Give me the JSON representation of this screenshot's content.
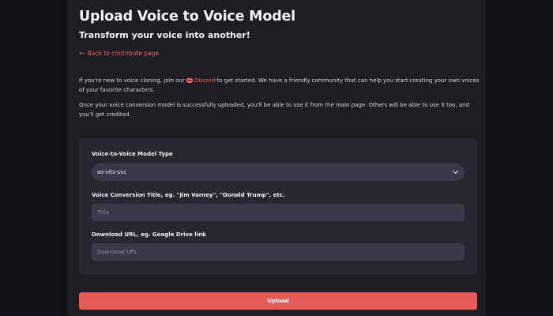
{
  "header": {
    "title": "Upload Voice to Voice Model",
    "subtitle": "Transform your voice into another!",
    "back_link": "Back to contribute page"
  },
  "intro": {
    "p1_before": "If you're new to voice cloning, join our",
    "discord_label": "Discord",
    "p1_after": "to get started. We have a friendly community that can help you start creating your own voices of your favorite characters.",
    "p2": "Once your voice conversion model is successfully uploaded, you'll be able to use it from the main page. Others will be able to use it too, and you'll get credited."
  },
  "form": {
    "model_type_label": "Voice-to-Voice Model Type",
    "model_type_value": "so-vits-svc",
    "title_label": "Voice Conversion Title, eg. \"Jim Varney\", \"Donald Trump\", etc.",
    "title_placeholder": "Title",
    "url_label": "Download URL, eg. Google Drive link",
    "url_placeholder": "Download URL",
    "submit_label": "Upload"
  },
  "colors": {
    "accent": "#e45b58",
    "background": "#1e1d24",
    "panel": "#28272f",
    "field": "#3a3947"
  },
  "icons": {
    "back": "arrow-left-icon",
    "discord": "discord-icon",
    "select": "chevron-down-icon"
  }
}
